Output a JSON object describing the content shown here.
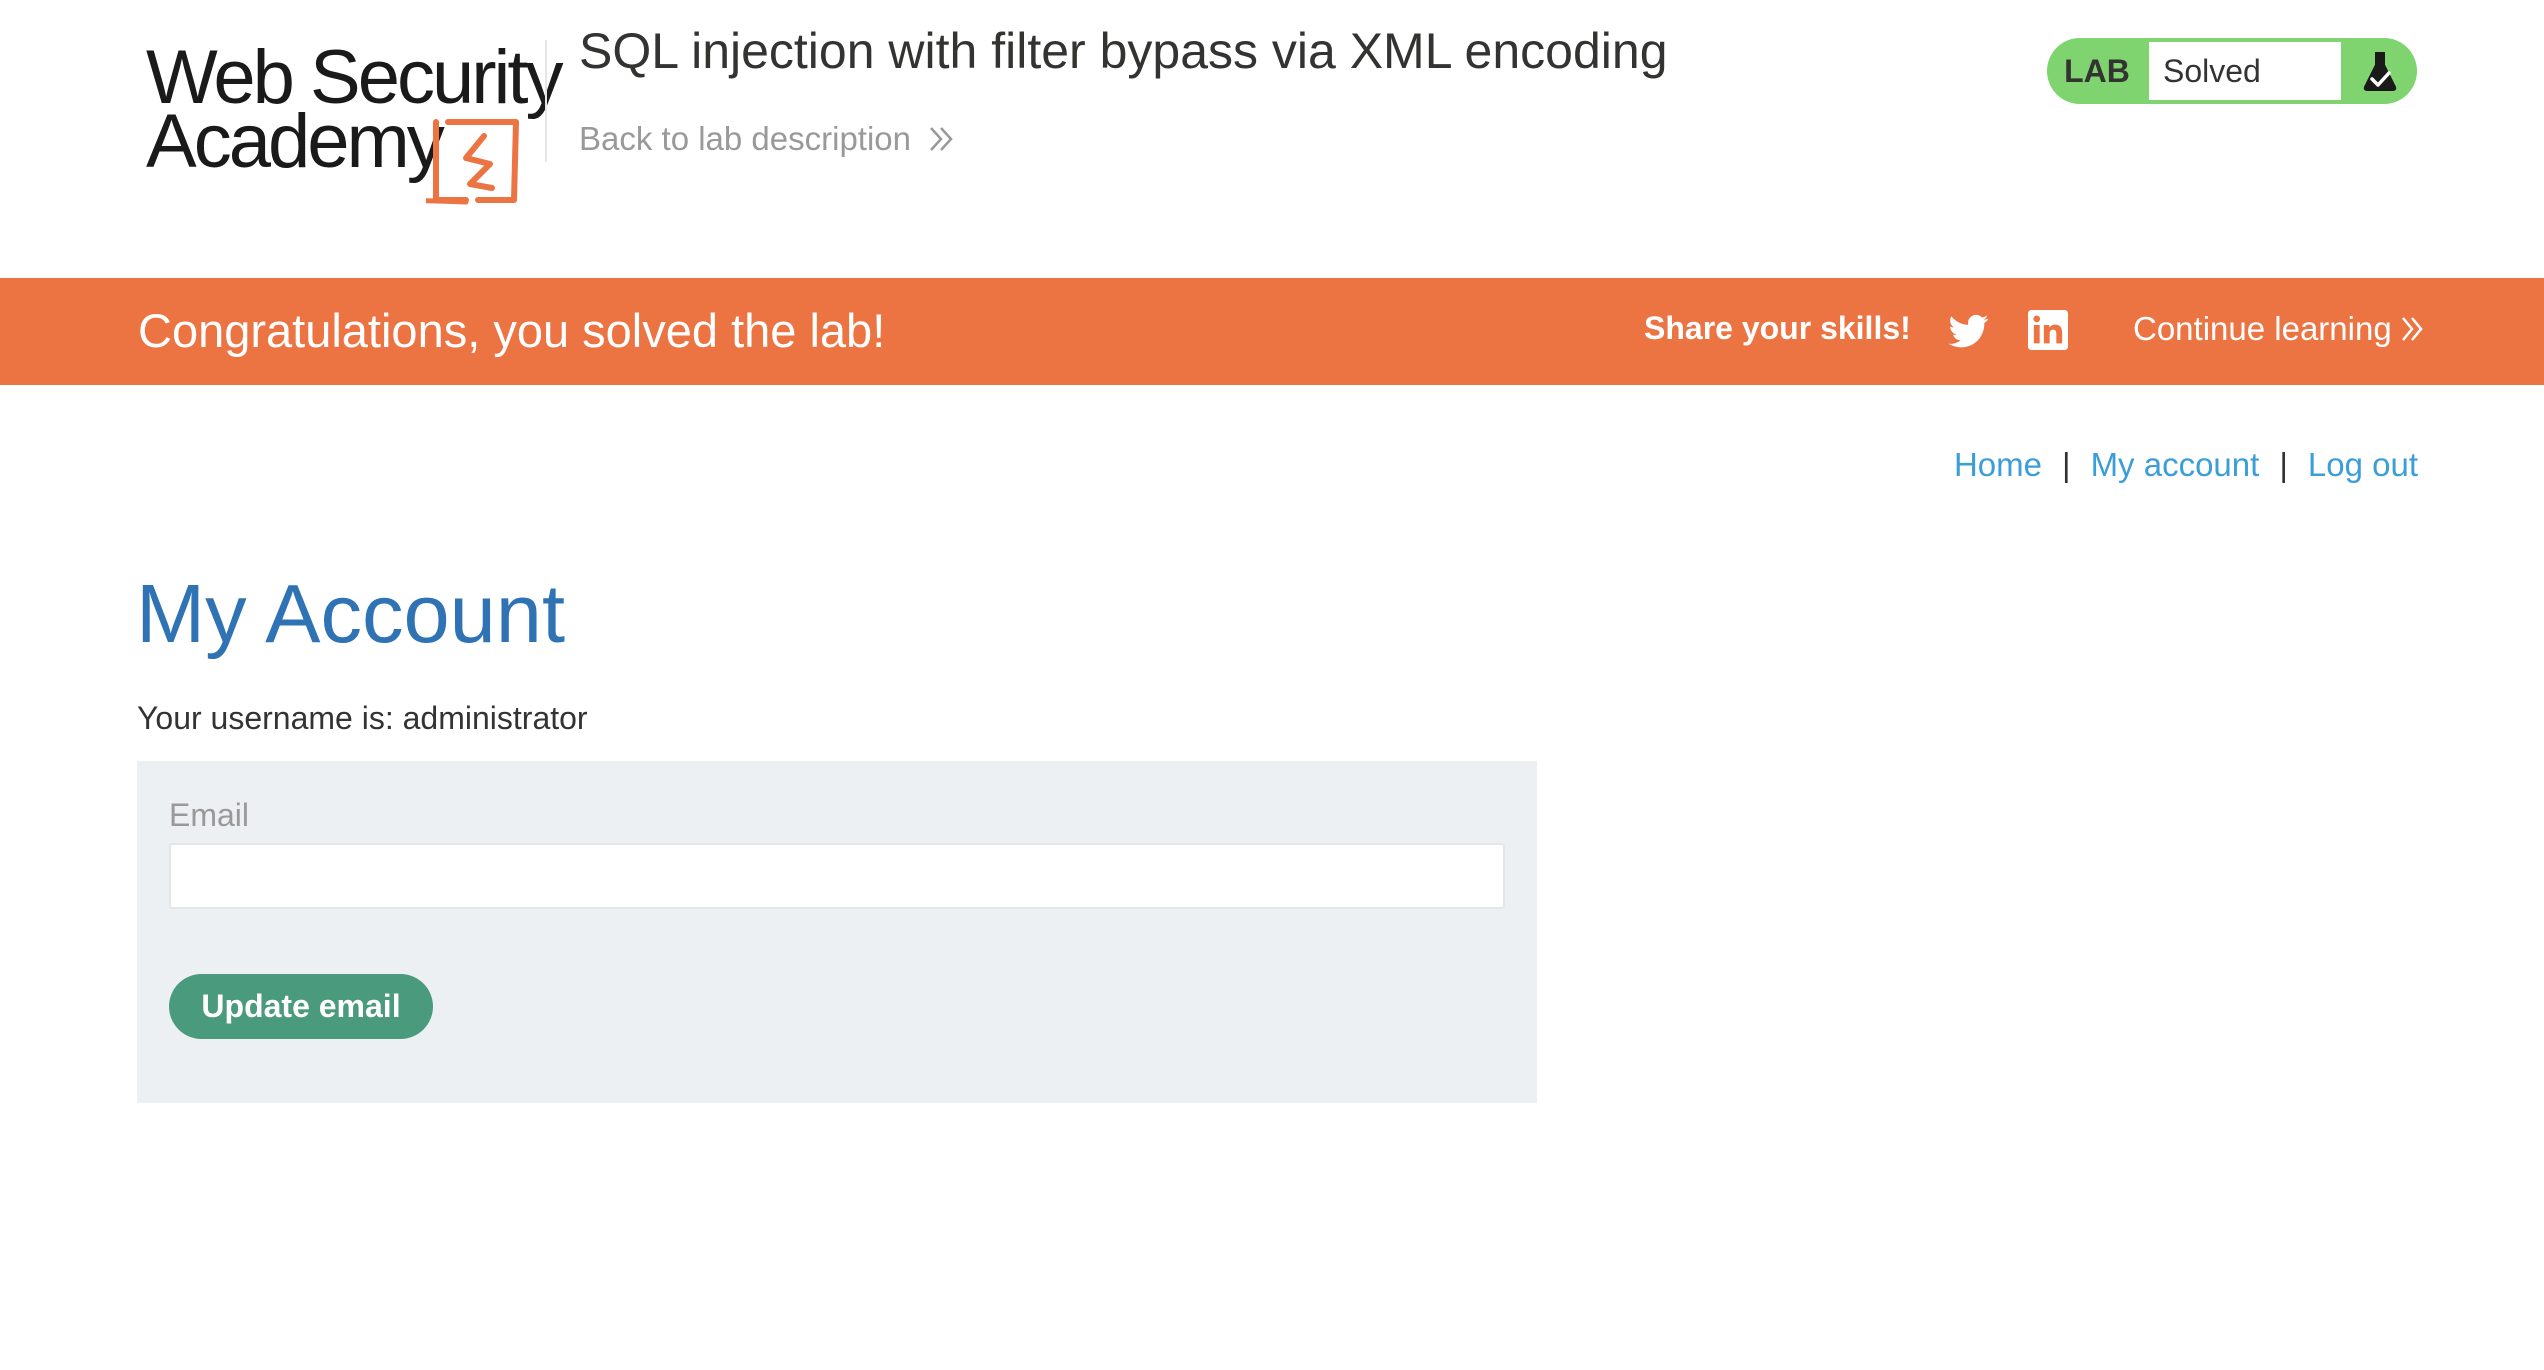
{
  "header": {
    "logo": {
      "line1": "Web Security",
      "line2": "Academy",
      "accent_color": "#ec7443"
    },
    "lab_title": "SQL injection with filter bypass via XML encoding",
    "back_link": "Back to lab description",
    "lab_badge": {
      "label": "LAB",
      "status": "Solved",
      "color": "#7fd46f",
      "icon": "flask-check-icon"
    }
  },
  "banner": {
    "message": "Congratulations, you solved the lab!",
    "share_label": "Share your skills!",
    "social_icons": [
      "twitter-icon",
      "linkedin-icon"
    ],
    "continue_label": "Continue learning",
    "background": "#ec7443"
  },
  "nav": {
    "home": "Home",
    "sep1": "|",
    "my_account": "My account",
    "sep2": "|",
    "log_out": "Log out",
    "link_color": "#3c9ed8"
  },
  "main": {
    "title": "My Account",
    "username_line": "Your username is: administrator",
    "email_form": {
      "label": "Email",
      "value": "",
      "button": "Update email",
      "button_color": "#4a9a7e"
    }
  }
}
